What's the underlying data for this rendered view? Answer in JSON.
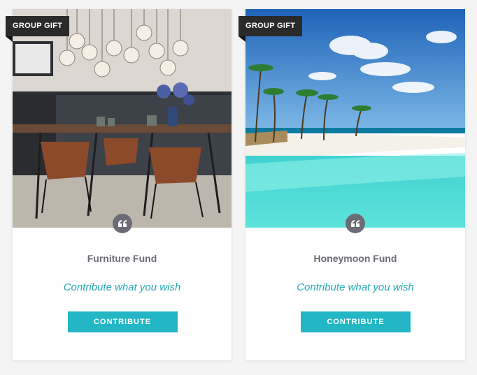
{
  "cards": [
    {
      "badge": "GROUP GIFT",
      "title": "Furniture Fund",
      "subtitle": "Contribute what you wish",
      "button": "CONTRIBUTE",
      "image": "dining-room-photo"
    },
    {
      "badge": "GROUP GIFT",
      "title": "Honeymoon Fund",
      "subtitle": "Contribute what you wish",
      "button": "CONTRIBUTE",
      "image": "tropical-beach-photo"
    }
  ],
  "colors": {
    "accent": "#23b7c5",
    "badge_bg": "#2a2a2a",
    "title_text": "#6a6b73",
    "quote_icon_bg": "#6b6c75"
  }
}
